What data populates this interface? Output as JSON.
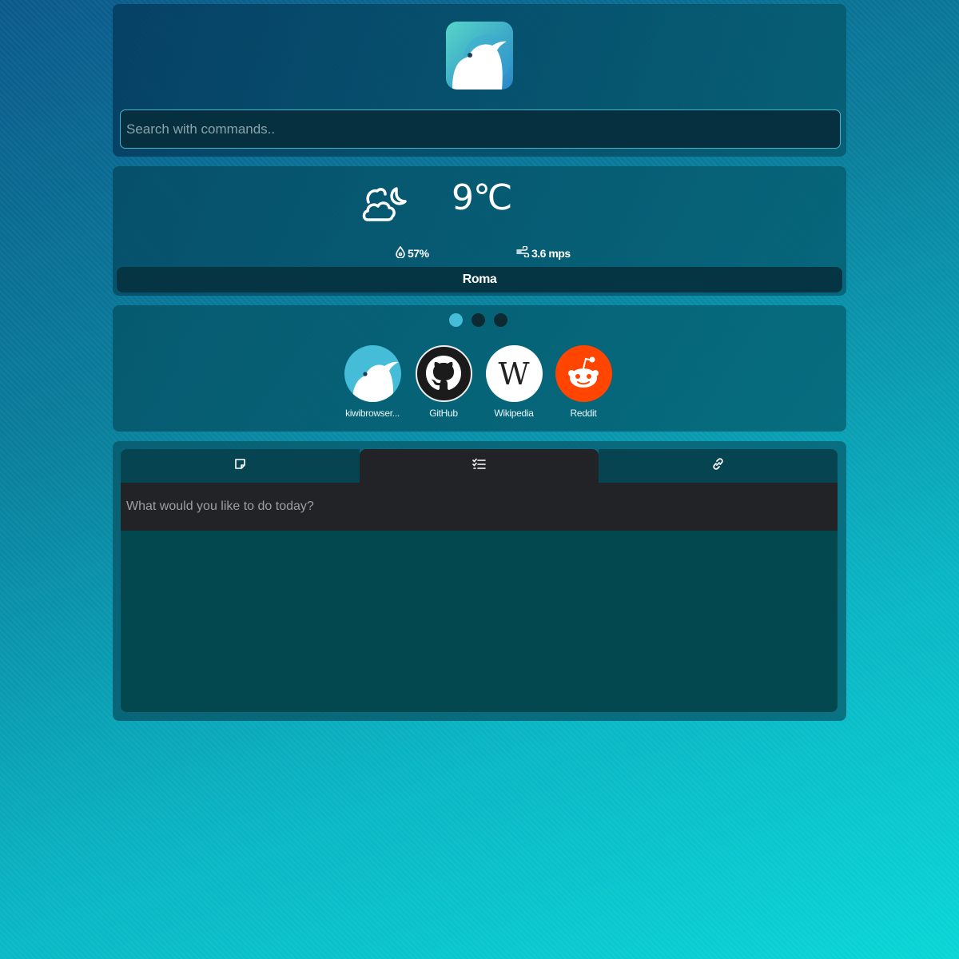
{
  "header": {
    "logo_icon": "kiwi-browser-logo-icon",
    "search": {
      "placeholder": "Search with commands..",
      "value": ""
    }
  },
  "weather": {
    "condition_icon": "cloud-moon-icon",
    "temperature": "9℃",
    "humidity": "57%",
    "wind": "3.6 mps",
    "city": "Roma"
  },
  "shortcuts": {
    "pages": 3,
    "active_page": 1,
    "items": [
      {
        "label": "kiwibrowser...",
        "icon": "kiwi-icon",
        "color": "#45bcd8"
      },
      {
        "label": "GitHub",
        "icon": "github-icon",
        "color": "#1b1b1b"
      },
      {
        "label": "Wikipedia",
        "icon": "wikipedia-icon",
        "color": "#ffffff"
      },
      {
        "label": "Reddit",
        "icon": "reddit-icon",
        "color": "#ff4500"
      }
    ]
  },
  "notes": {
    "tabs": [
      {
        "icon": "sticky-note-icon",
        "active": false
      },
      {
        "icon": "checklist-icon",
        "active": true
      },
      {
        "icon": "link-icon",
        "active": false
      }
    ],
    "todo_placeholder": "What would you like to do today?"
  }
}
